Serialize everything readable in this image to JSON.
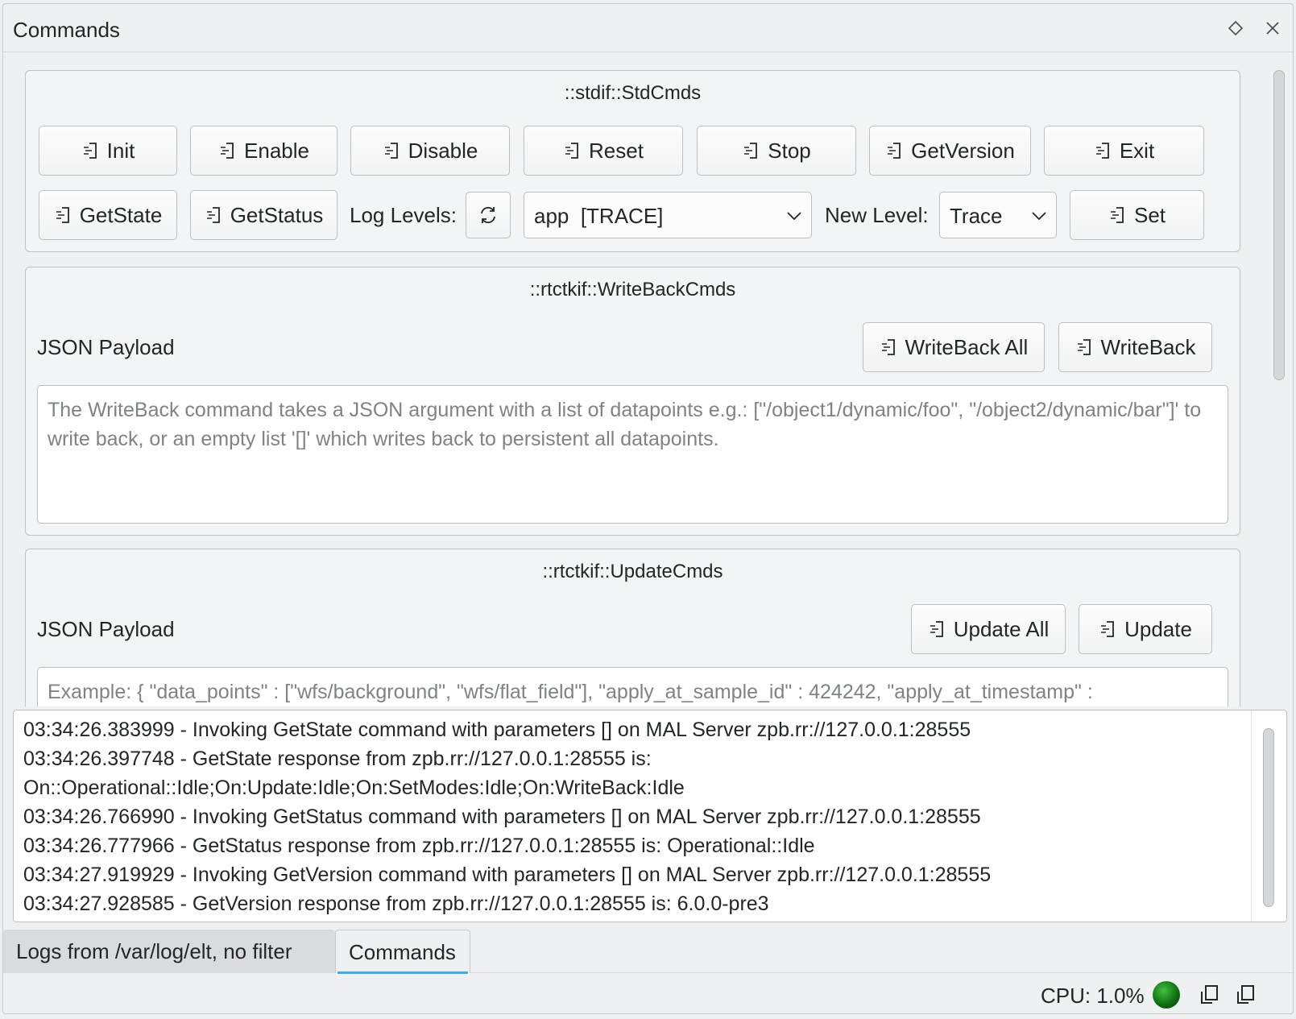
{
  "window": {
    "title": "Commands"
  },
  "std_cmds": {
    "title": "::stdif::StdCmds",
    "buttons": [
      "Init",
      "Enable",
      "Disable",
      "Reset",
      "Stop",
      "GetVersion",
      "Exit"
    ],
    "get_state": "GetState",
    "get_status": "GetStatus",
    "log_levels_label": "Log Levels:",
    "logger_select": "app  [TRACE]",
    "new_level_label": "New Level:",
    "new_level_select": "Trace",
    "set_button": "Set"
  },
  "writeback_cmds": {
    "title": "::rtctkif::WriteBackCmds",
    "payload_label": "JSON Payload",
    "writeback_all": "WriteBack All",
    "writeback": "WriteBack",
    "placeholder": "The WriteBack command takes a JSON argument with a list of datapoints e.g.: [\"/object1/dynamic/foo\", \"/object2/dynamic/bar\"]' to write back, or an empty list '[]' which writes back to persistent all datapoints."
  },
  "update_cmds": {
    "title": "::rtctkif::UpdateCmds",
    "payload_label": "JSON Payload",
    "update_all": "Update All",
    "update": "Update",
    "placeholder": "Example: { \"data_points\" : [\"wfs/background\", \"wfs/flat_field\"], \"apply_at_sample_id\" : 424242, \"apply_at_timestamp\" :"
  },
  "log": {
    "lines": [
      "03:34:26.383999 - Invoking GetState command with parameters [] on MAL Server zpb.rr://127.0.0.1:28555",
      "03:34:26.397748 - GetState response from zpb.rr://127.0.0.1:28555 is:",
      "On::Operational::Idle;On:Update:Idle;On:SetModes:Idle;On:WriteBack:Idle",
      "03:34:26.766990 - Invoking GetStatus command with parameters [] on MAL Server zpb.rr://127.0.0.1:28555",
      "03:34:26.777966 - GetStatus response from zpb.rr://127.0.0.1:28555 is: Operational::Idle",
      "03:34:27.919929 - Invoking GetVersion command with parameters [] on MAL Server zpb.rr://127.0.0.1:28555",
      "03:34:27.928585 - GetVersion response from zpb.rr://127.0.0.1:28555 is: 6.0.0-pre3"
    ]
  },
  "tabs": [
    {
      "label": "Logs from /var/log/elt, no filter",
      "active": false
    },
    {
      "label": "Commands",
      "active": true
    }
  ],
  "status": {
    "cpu": "CPU: 1.0%",
    "led_color": "#1a8a1a"
  },
  "icons": {
    "command": "command-icon",
    "refresh": "refresh-icon",
    "chevron": "chevron-down-icon"
  }
}
